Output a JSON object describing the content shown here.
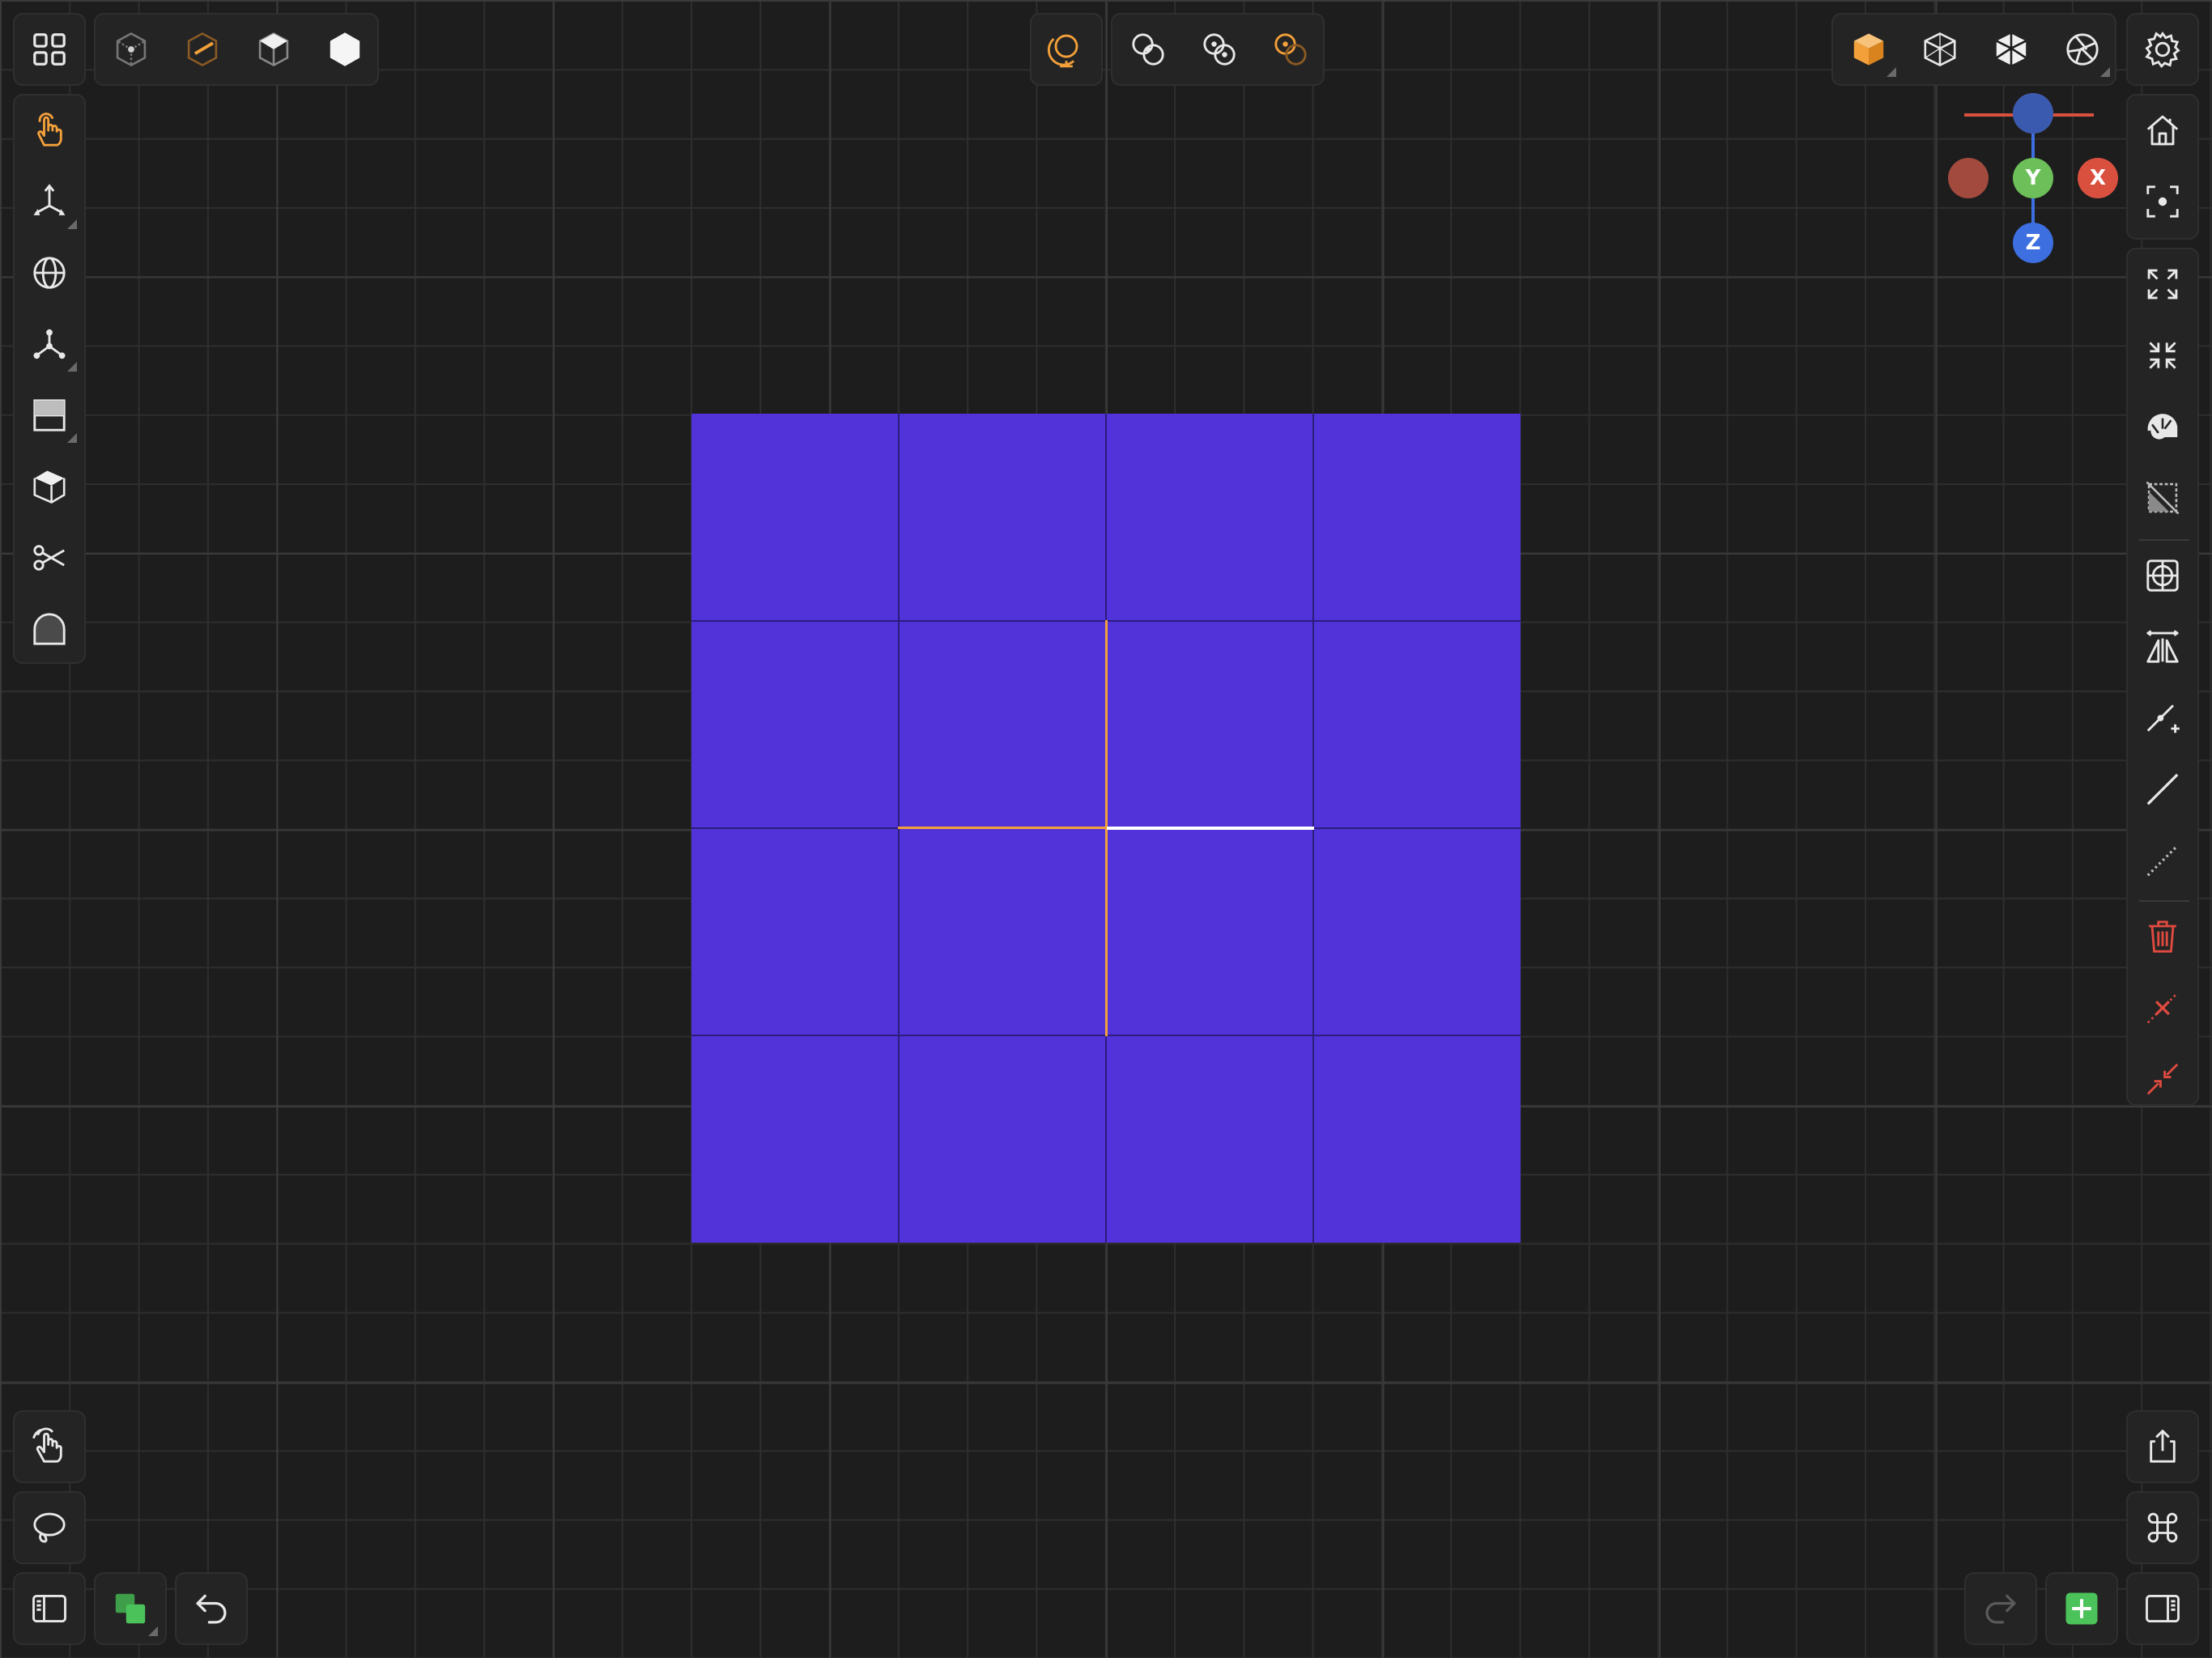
{
  "gizmo": {
    "x_label": "X",
    "y_label": "Y",
    "z_label": "Z",
    "x_color": "#d9503f",
    "neg_x_color": "#a34a3e",
    "y_color": "#6dbf5a",
    "z_color": "#3d6fe0",
    "neg_z_color": "#3a5ab0"
  },
  "colors": {
    "accent": "#f3a03a",
    "mesh_face": "#5232d9",
    "selected_edge_orange": "#f3a03a",
    "selected_edge_white": "#ffffff",
    "danger": "#e04a3f",
    "add_button": "#4cc35a"
  },
  "toolbars": {
    "top_left_icons": [
      "grid-menu-icon",
      "vertex-mode-icon",
      "edge-mode-icon",
      "face-mode-icon",
      "object-mode-icon"
    ],
    "top_center_icons": [
      "world-space-icon",
      "pivot-center-icon",
      "pivot-individual-icon",
      "pivot-active-icon"
    ],
    "top_right_icons": [
      "solid-shading-icon",
      "wireframe-shading-icon",
      "xray-shading-icon",
      "material-shading-icon",
      "settings-icon"
    ],
    "left_tools": [
      "select-hand-icon",
      "move-gizmo-icon",
      "rotate-sphere-icon",
      "transform-axes-icon",
      "loop-cut-icon",
      "extrude-icon",
      "knife-icon",
      "bevel-icon"
    ],
    "right_tools": [
      "home-view-icon",
      "focus-frame-icon",
      "expand-icon",
      "shrink-icon",
      "spiral-icon",
      "hide-icon",
      "snap-icon",
      "mirror-icon",
      "subdivide-edge-icon",
      "edge-icon",
      "dashed-edge-icon",
      "delete-icon",
      "dissolve-icon",
      "merge-icon"
    ],
    "bottom_left": [
      "gesture-hand-icon",
      "lasso-icon",
      "sidebar-left-icon",
      "layers-icon",
      "undo-icon"
    ],
    "bottom_right": [
      "share-icon",
      "command-icon",
      "redo-icon",
      "add-icon",
      "sidebar-right-icon"
    ]
  }
}
